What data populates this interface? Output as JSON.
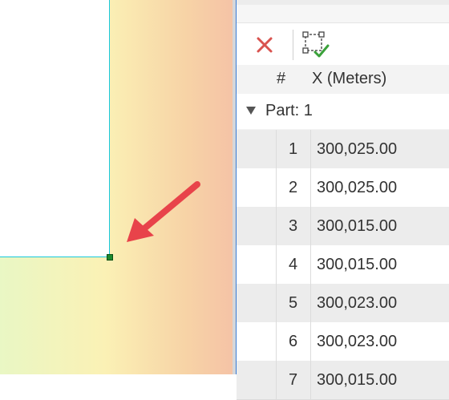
{
  "table": {
    "header_num": "#",
    "header_x": "X (Meters)",
    "part_label": "Part: 1",
    "rows": [
      {
        "index": "1",
        "x": "300,025.00"
      },
      {
        "index": "2",
        "x": "300,025.00"
      },
      {
        "index": "3",
        "x": "300,015.00"
      },
      {
        "index": "4",
        "x": "300,015.00"
      },
      {
        "index": "5",
        "x": "300,023.00"
      },
      {
        "index": "6",
        "x": "300,023.00"
      },
      {
        "index": "7",
        "x": "300,015.00"
      }
    ]
  },
  "toolbar": {
    "close_icon": "close-x-icon",
    "finish_icon": "finish-sketch-check-icon"
  },
  "colors": {
    "accent_cyan": "#17c9dc",
    "vertex_green": "#1c8a2e",
    "arrow_red": "#e8434a",
    "close_red": "#d9534f",
    "check_green": "#3aa13a"
  }
}
